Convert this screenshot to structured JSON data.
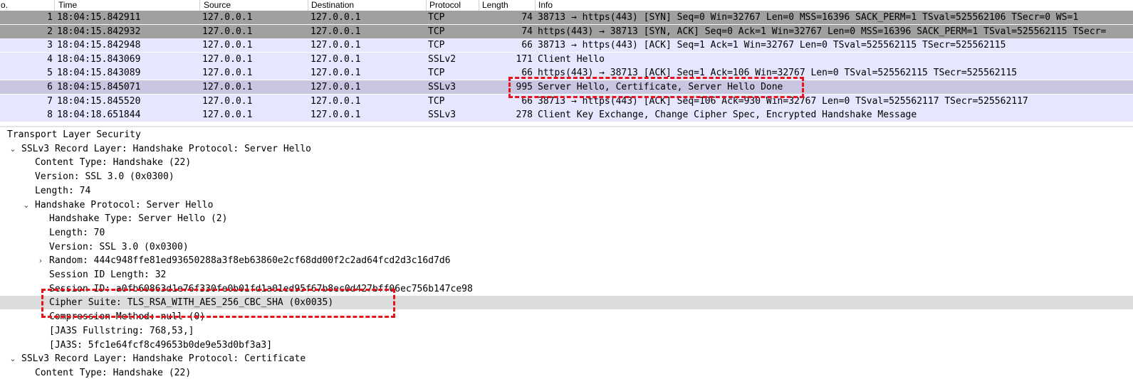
{
  "columns": {
    "no": "o.",
    "time": "Time",
    "source": "Source",
    "destination": "Destination",
    "protocol": "Protocol",
    "length": "Length",
    "info": "Info"
  },
  "packets": [
    {
      "no": "1",
      "time": "18:04:15.842911",
      "source": "127.0.0.1",
      "destination": "127.0.0.1",
      "protocol": "TCP",
      "length": "74",
      "info": "38713 → https(443) [SYN] Seq=0 Win=32767 Len=0 MSS=16396 SACK_PERM=1 TSval=525562106 TSecr=0 WS=1"
    },
    {
      "no": "2",
      "time": "18:04:15.842932",
      "source": "127.0.0.1",
      "destination": "127.0.0.1",
      "protocol": "TCP",
      "length": "74",
      "info": "https(443) → 38713 [SYN, ACK] Seq=0 Ack=1 Win=32767 Len=0 MSS=16396 SACK_PERM=1 TSval=525562115 TSecr="
    },
    {
      "no": "3",
      "time": "18:04:15.842948",
      "source": "127.0.0.1",
      "destination": "127.0.0.1",
      "protocol": "TCP",
      "length": "66",
      "info": "38713 → https(443) [ACK] Seq=1 Ack=1 Win=32767 Len=0 TSval=525562115 TSecr=525562115"
    },
    {
      "no": "4",
      "time": "18:04:15.843069",
      "source": "127.0.0.1",
      "destination": "127.0.0.1",
      "protocol": "SSLv2",
      "length": "171",
      "info": "Client Hello"
    },
    {
      "no": "5",
      "time": "18:04:15.843089",
      "source": "127.0.0.1",
      "destination": "127.0.0.1",
      "protocol": "TCP",
      "length": "66",
      "info": "https(443) → 38713 [ACK] Seq=1 Ack=106 Win=32767 Len=0 TSval=525562115 TSecr=525562115"
    },
    {
      "no": "6",
      "time": "18:04:15.845071",
      "source": "127.0.0.1",
      "destination": "127.0.0.1",
      "protocol": "SSLv3",
      "length": "995",
      "info": "Server Hello, Certificate, Server Hello Done"
    },
    {
      "no": "7",
      "time": "18:04:15.845520",
      "source": "127.0.0.1",
      "destination": "127.0.0.1",
      "protocol": "TCP",
      "length": "66",
      "info": "38713 → https(443) [ACK] Seq=106 Ack=930 Win=32767 Len=0 TSval=525562117 TSecr=525562117"
    },
    {
      "no": "8",
      "time": "18:04:18.651844",
      "source": "127.0.0.1",
      "destination": "127.0.0.1",
      "protocol": "SSLv3",
      "length": "278",
      "info": "Client Key Exchange, Change Cipher Spec, Encrypted Handshake Message"
    }
  ],
  "details": [
    {
      "text": "Transport Layer Security",
      "arrow": ""
    },
    {
      "text": "SSLv3 Record Layer: Handshake Protocol: Server Hello",
      "arrow": "expanded"
    },
    {
      "text": "Content Type: Handshake (22)",
      "arrow": ""
    },
    {
      "text": "Version: SSL 3.0 (0x0300)",
      "arrow": ""
    },
    {
      "text": "Length: 74",
      "arrow": ""
    },
    {
      "text": "Handshake Protocol: Server Hello",
      "arrow": "expanded"
    },
    {
      "text": "Handshake Type: Server Hello (2)",
      "arrow": ""
    },
    {
      "text": "Length: 70",
      "arrow": ""
    },
    {
      "text": "Version: SSL 3.0 (0x0300)",
      "arrow": ""
    },
    {
      "text": "Random: 444c948ffe81ed93650288a3f8eb63860e2cf68dd00f2c2ad64fcd2d3c16d7d6",
      "arrow": "collapsed"
    },
    {
      "text": "Session ID Length: 32",
      "arrow": ""
    },
    {
      "text": "Session ID: a0fb60863d1e76f330fe0b01fd1a01ed95f67b8ec0d427bff06ec756b147ce98",
      "arrow": ""
    },
    {
      "text": "Cipher Suite: TLS_RSA_WITH_AES_256_CBC_SHA (0x0035)",
      "arrow": "",
      "highlight": true
    },
    {
      "text": "Compression Method: null (0)",
      "arrow": ""
    },
    {
      "text": "[JA3S Fullstring: 768,53,]",
      "arrow": ""
    },
    {
      "text": "[JA3S: 5fc1e64fcf8c49653b0de9e53d0bf3a3]",
      "arrow": ""
    },
    {
      "text": "SSLv3 Record Layer: Handshake Protocol: Certificate",
      "arrow": "expanded"
    },
    {
      "text": "Content Type: Handshake (22)",
      "arrow": ""
    }
  ],
  "colors": {
    "syn_row": "#a0a0a0",
    "tcp_row": "#e7e6ff",
    "selected_row": "#c8c6e0",
    "highlight_detail": "#dcdcdc",
    "annotation": "#e8141c"
  }
}
